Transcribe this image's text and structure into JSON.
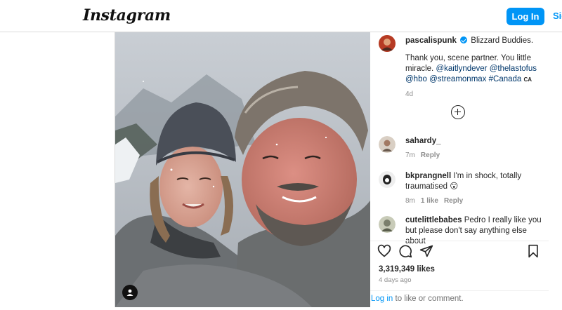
{
  "app": {
    "logo": "Instagram"
  },
  "header": {
    "login_label": "Log In",
    "signup_label": "Sign Up"
  },
  "post": {
    "author": "pascalispunk",
    "caption_title": "Blizzard Buddies.",
    "caption_line1": "Thank you, scene partner. You little miracle.",
    "mentions": [
      "@kaitlyndever",
      "@thelastofus",
      "@hbo",
      "@streamonmax",
      "#Canada"
    ],
    "country_tag": "CA",
    "time_ago": "4d",
    "likes": "3,319,349 likes",
    "posted": "4 days ago"
  },
  "comments": [
    {
      "user": "sahardy_",
      "text": "",
      "time": "7m",
      "reply": "Reply",
      "likes": ""
    },
    {
      "user": "bkprangnell",
      "text": "I'm in shock, totally traumatised 😮",
      "time": "8m",
      "likes": "1 like",
      "reply": "Reply"
    },
    {
      "user": "cutelittlebabes",
      "text": "Pedro I really like you but please don't say anything else about",
      "time": "",
      "likes": "",
      "reply": ""
    }
  ],
  "footer": {
    "login_link": "Log in",
    "suffix": " to like or comment."
  },
  "icons": [
    "heart-icon",
    "comment-icon",
    "share-icon",
    "bookmark-icon",
    "add-comments-icon",
    "user-tag-icon",
    "verified-badge-icon"
  ]
}
